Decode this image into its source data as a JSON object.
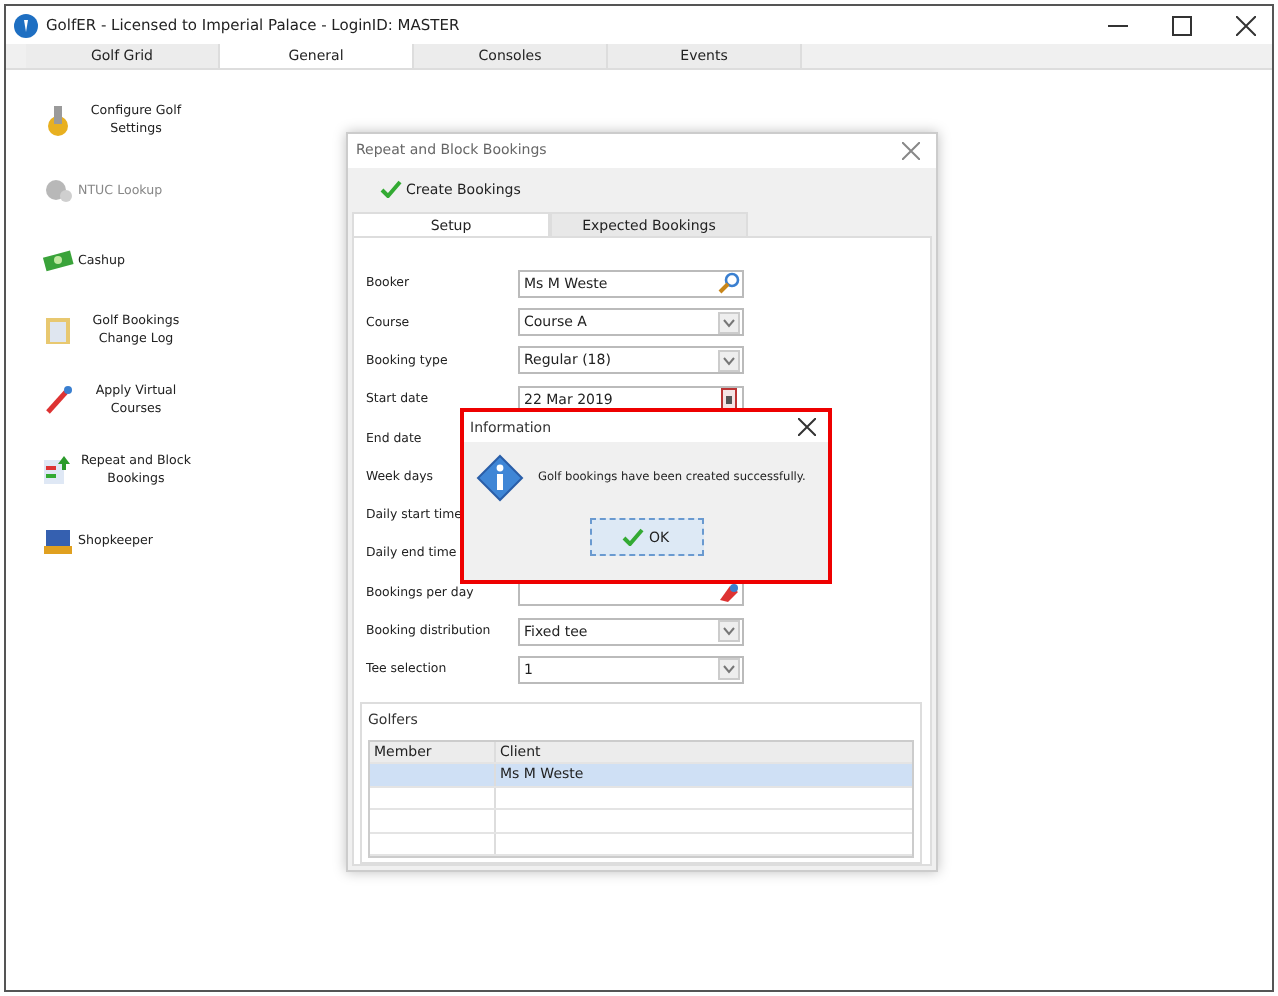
{
  "window": {
    "title": "GolfER - Licensed to Imperial Palace - LoginID: MASTER"
  },
  "tabs": [
    {
      "label": "Golf Grid",
      "selected": false
    },
    {
      "label": "General",
      "selected": true
    },
    {
      "label": "Consoles",
      "selected": false
    },
    {
      "label": "Events",
      "selected": false
    }
  ],
  "sidebar": {
    "items": [
      {
        "label": "Configure Golf Settings",
        "kind": "gear",
        "disabled": false
      },
      {
        "label": "NTUC Lookup",
        "kind": "gears",
        "disabled": true
      },
      {
        "label": "Cashup",
        "kind": "cash",
        "disabled": false
      },
      {
        "label": "Golf Bookings Change Log",
        "kind": "clipboard",
        "disabled": false
      },
      {
        "label": "Apply Virtual Courses",
        "kind": "wand",
        "disabled": false
      },
      {
        "label": "Repeat and Block Bookings",
        "kind": "list",
        "disabled": false
      },
      {
        "label": "Shopkeeper",
        "kind": "shop",
        "disabled": false
      }
    ]
  },
  "dialog": {
    "title": "Repeat and Block Bookings",
    "toolbar": {
      "label": "Create Bookings"
    },
    "tabs": [
      {
        "label": "Setup",
        "selected": true
      },
      {
        "label": "Expected Bookings",
        "selected": false
      }
    ],
    "fields": [
      {
        "label": "Booker",
        "kind": "search",
        "value": "Ms M Weste"
      },
      {
        "label": "Course",
        "kind": "combo",
        "value": "Course A"
      },
      {
        "label": "Booking type",
        "kind": "combo",
        "value": "Regular (18)"
      },
      {
        "label": "Start date",
        "kind": "date",
        "value": "22 Mar 2019"
      },
      {
        "label": "End date",
        "kind": "hidden"
      },
      {
        "label": "Week days",
        "kind": "hidden"
      },
      {
        "label": "Daily start time",
        "kind": "hidden"
      },
      {
        "label": "Daily end time",
        "kind": "hidden"
      },
      {
        "label": "Bookings per day",
        "kind": "picker"
      },
      {
        "label": "Booking distribution",
        "kind": "combo",
        "value": "Fixed tee"
      },
      {
        "label": "Tee selection",
        "kind": "combo",
        "value": "1"
      }
    ],
    "golfers": {
      "title": "Golfers",
      "columns": [
        "Member",
        "Client"
      ],
      "rows": [
        {
          "cells": [
            "",
            "Ms M Weste"
          ],
          "selected": true
        },
        {
          "cells": [
            "",
            ""
          ],
          "selected": false
        },
        {
          "cells": [
            "",
            ""
          ],
          "selected": false
        },
        {
          "cells": [
            "",
            ""
          ],
          "selected": false
        }
      ]
    }
  },
  "message_box": {
    "title": "Information",
    "message": "Golf bookings have been created successfully.",
    "button": "OK"
  }
}
